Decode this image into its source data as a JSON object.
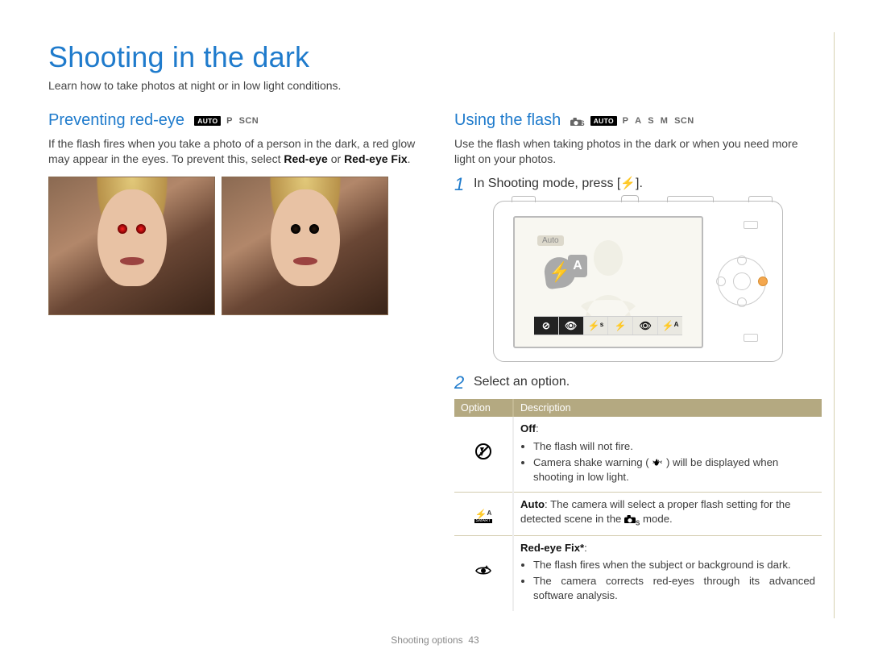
{
  "title": "Shooting in the dark",
  "intro": "Learn how to take photos at night or in low light conditions.",
  "left": {
    "heading": "Preventing red-eye",
    "modes_filled": "AUTO",
    "modes_plain": [
      "P",
      "SCN"
    ],
    "body_a": "If the flash fires when you take a photo of a person in the dark, a red glow may appear in the eyes. To prevent this, select ",
    "body_b_bold": "Red-eye",
    "body_c": " or ",
    "body_d_bold": "Red-eye Fix",
    "body_e": "."
  },
  "right": {
    "heading": "Using the flash",
    "modes_plain_pre": "S",
    "modes_filled": "AUTO",
    "modes_plain_post": [
      "P",
      "A",
      "S",
      "M",
      "SCN"
    ],
    "body": "Use the flash when taking photos in the dark or when you need more light on your photos.",
    "step1_num": "1",
    "step1_text_a": "In Shooting mode, press [",
    "step1_text_b": "].",
    "step2_num": "2",
    "step2_text": "Select an option.",
    "camera_auto_label": "Auto",
    "iconbar": [
      "off",
      "redeye",
      "slow",
      "fill",
      "eye",
      "autoA"
    ]
  },
  "table": {
    "head_option": "Option",
    "head_desc": "Description",
    "rows": [
      {
        "icon": "off",
        "title": "Off",
        "bullets": [
          "The flash will not fire.",
          "Camera shake warning ( __SHAKE__ ) will be displayed when shooting in low light."
        ]
      },
      {
        "icon": "auto",
        "title_inline": "Auto",
        "inline_text_a": ": The camera will select a proper flash setting for the detected scene in the ",
        "inline_text_b": " mode."
      },
      {
        "icon": "redeye",
        "title": "Red-eye Fix*",
        "bullets": [
          "The flash fires when the subject or background is dark.",
          "The camera corrects red-eyes through its advanced software analysis."
        ]
      }
    ]
  },
  "footer_section": "Shooting options",
  "footer_page": "43"
}
